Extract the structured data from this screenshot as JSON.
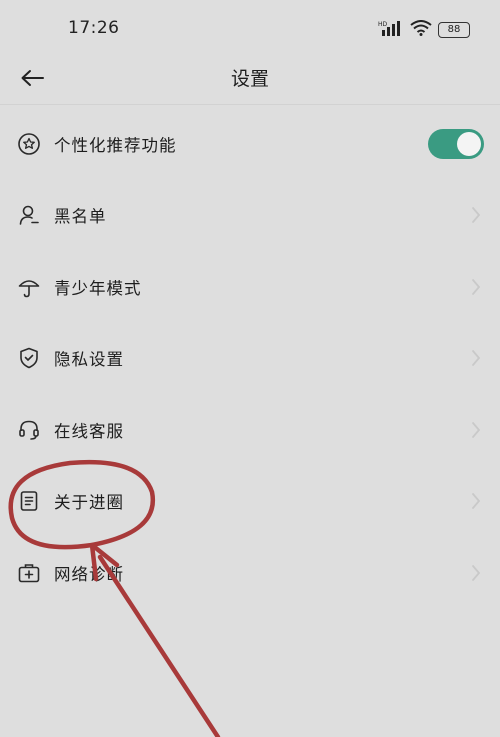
{
  "status_bar": {
    "time": "17:26",
    "network_label": "HD",
    "battery_level": "88"
  },
  "header": {
    "title": "设置",
    "back_icon": "arrow-left-icon"
  },
  "settings": {
    "items": [
      {
        "label": "个性化推荐功能",
        "icon": "shield-star-icon",
        "control": "toggle",
        "toggle_on": true
      },
      {
        "label": "黑名单",
        "icon": "person-icon",
        "control": "chevron"
      },
      {
        "label": "青少年模式",
        "icon": "umbrella-icon",
        "control": "chevron"
      },
      {
        "label": "隐私设置",
        "icon": "shield-check-icon",
        "control": "chevron"
      },
      {
        "label": "在线客服",
        "icon": "headset-icon",
        "control": "chevron"
      },
      {
        "label": "关于进圈",
        "icon": "document-icon",
        "control": "chevron"
      },
      {
        "label": "网络诊断",
        "icon": "medical-kit-icon",
        "control": "chevron"
      }
    ]
  },
  "colors": {
    "background": "#dedede",
    "accent": "#3a9b82",
    "annotation": "#a83a3a"
  }
}
